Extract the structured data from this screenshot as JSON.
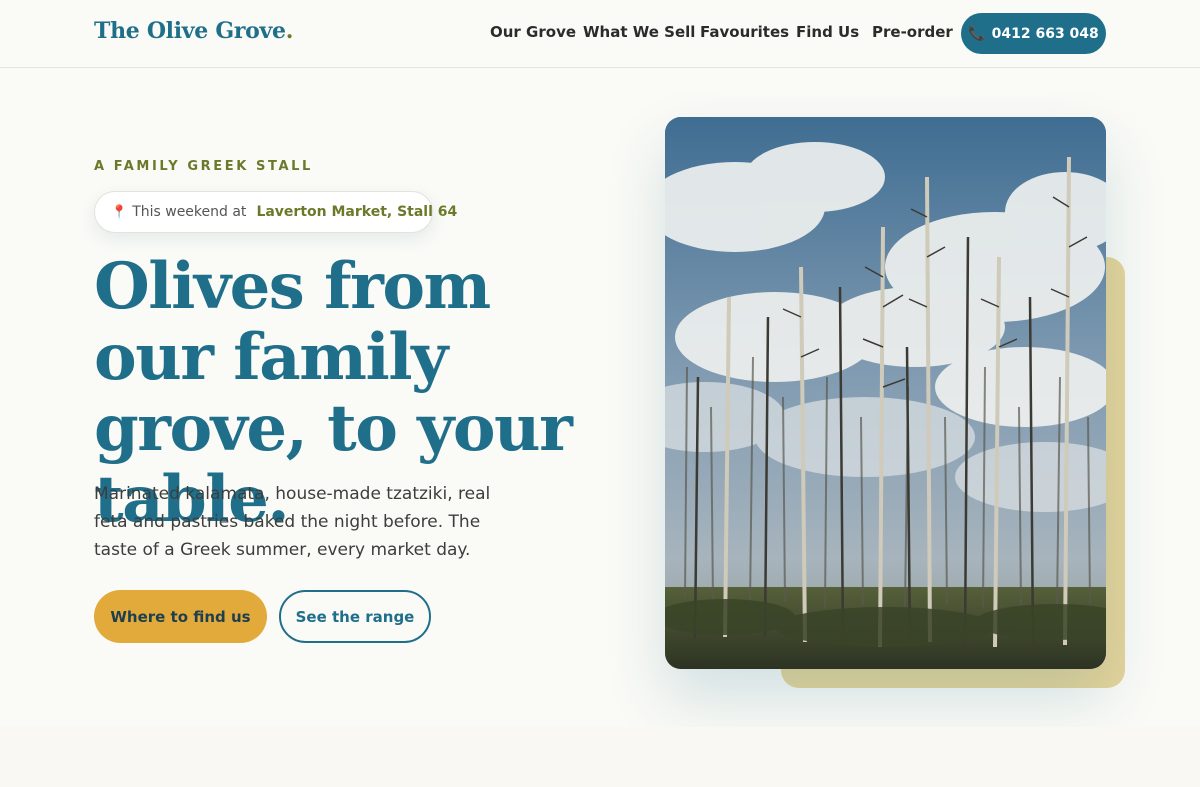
{
  "header": {
    "logo_text": "The Olive Grove",
    "logo_dot": ".",
    "nav": [
      "Our Grove",
      "What We Sell",
      "Favourites",
      "Find Us",
      "Pre-order"
    ],
    "phone_icon": "📞",
    "phone_number": "0412 663 048"
  },
  "hero": {
    "eyebrow": "A FAMILY GREEK STALL",
    "location": {
      "icon": "📍",
      "prefix": "This weekend at",
      "place": "Laverton Market, Stall 64"
    },
    "headline": "Olives from our family grove, to your table.",
    "description": "Marinated kalamata, house-made tzatziki, real feta and pastries baked the night before. The taste of a Greek summer, every market day.",
    "primary_button": "Where to find us",
    "secondary_button": "See the range"
  },
  "colors": {
    "brand_blue": "#1f6f8b",
    "olive_green": "#6b7a2a",
    "mustard": "#e2a93b",
    "accent_sand": "#e6d49a",
    "background": "#fafaf6"
  },
  "icons": {
    "phone": "phone-icon",
    "location": "map-pin-icon"
  }
}
